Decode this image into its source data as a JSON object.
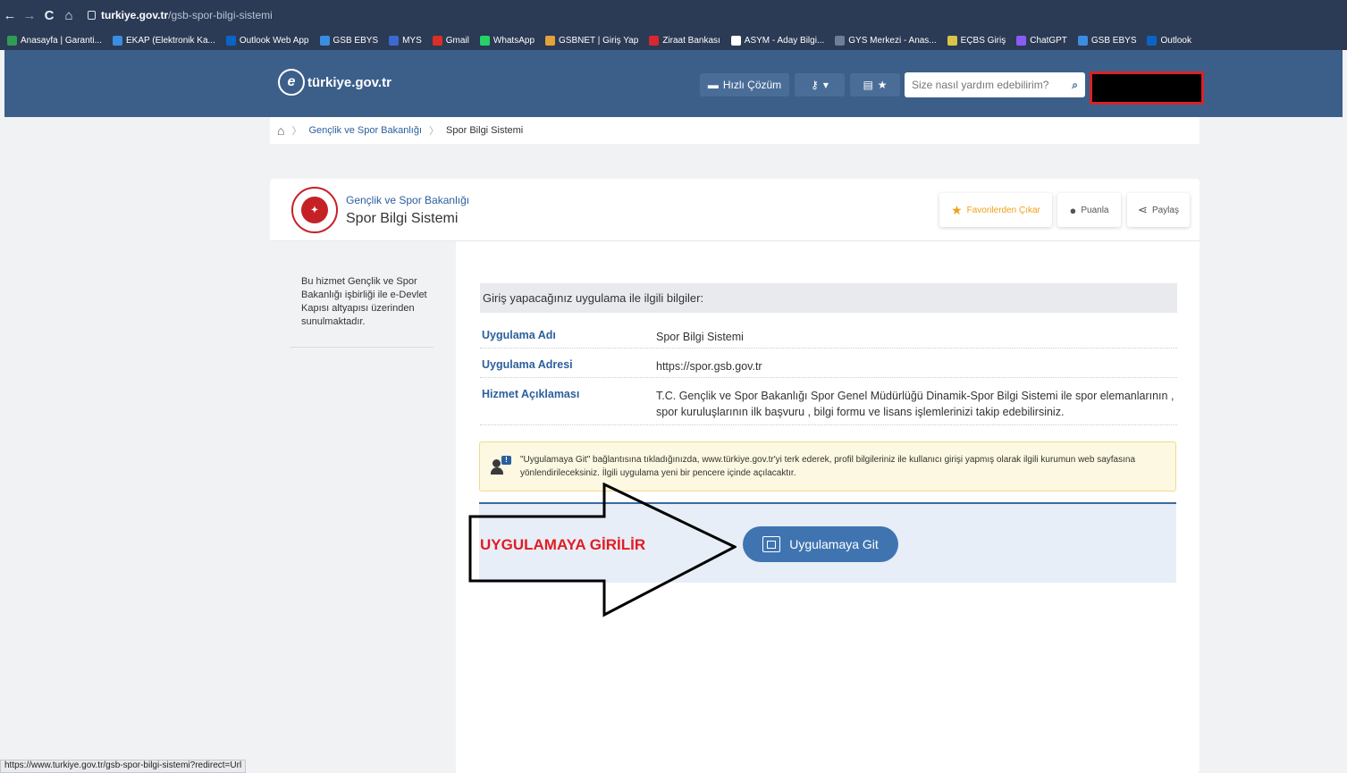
{
  "browser": {
    "url_host": "turkiye.gov.tr",
    "url_path": "/gsb-spor-bilgi-sistemi",
    "status_url": "https://www.turkiye.gov.tr/gsb-spor-bilgi-sistemi?redirect=Url"
  },
  "bookmarks": [
    {
      "label": "Anasayfa | Garanti...",
      "color": "#2e9c52"
    },
    {
      "label": "EKAP (Elektronik Ka...",
      "color": "#3a8de0"
    },
    {
      "label": "Outlook Web App",
      "color": "#0a64c6"
    },
    {
      "label": "GSB EBYS",
      "color": "#3a8de0"
    },
    {
      "label": "MYS",
      "color": "#3a6ad0"
    },
    {
      "label": "Gmail",
      "color": "#d93025"
    },
    {
      "label": "WhatsApp",
      "color": "#25d366"
    },
    {
      "label": "GSBNET | Giriş Yap",
      "color": "#e2a33b"
    },
    {
      "label": "Ziraat Bankası",
      "color": "#d9272e"
    },
    {
      "label": "ASYM - Aday Bilgi...",
      "color": "#ffffff"
    },
    {
      "label": "GYS Merkezi - Anas...",
      "color": "#6f7d96"
    },
    {
      "label": "EÇBS Giriş",
      "color": "#d9c44a"
    },
    {
      "label": "ChatGPT",
      "color": "#8a5cf6"
    },
    {
      "label": "GSB EBYS",
      "color": "#3a8de0"
    },
    {
      "label": "Outlook",
      "color": "#0a64c6"
    }
  ],
  "header": {
    "logo_text": "türkiye.gov.tr",
    "quick_solution": "Hızlı Çözüm",
    "search_placeholder": "Size nasıl yardım edebilirim?"
  },
  "breadcrumb": {
    "ministry": "Gençlik ve Spor Bakanlığı",
    "current": "Spor Bilgi Sistemi"
  },
  "card": {
    "org": "Gençlik ve Spor Bakanlığı",
    "service": "Spor Bilgi Sistemi",
    "favorite_label": "Favorilerden Çıkar",
    "rate_label": "Puanla",
    "share_label": "Paylaş"
  },
  "sidebar": {
    "text": "Bu hizmet Gençlik ve Spor Bakanlığı işbirliği ile e-Devlet Kapısı altyapısı üzerinden sunulmaktadır."
  },
  "info": {
    "title": "Giriş yapacağınız uygulama ile ilgili bilgiler:",
    "app_name_key": "Uygulama Adı",
    "app_name_val": "Spor Bilgi Sistemi",
    "app_addr_key": "Uygulama Adresi",
    "app_addr_val": "https://spor.gsb.gov.tr",
    "desc_key": "Hizmet Açıklaması",
    "desc_val": "T.C. Gençlik ve Spor Bakanlığı Spor Genel Müdürlüğü Dinamik-Spor Bilgi Sistemi ile spor elemanlarının , spor kuruluşlarının ilk başvuru , bilgi formu ve lisans işlemlerinizi takip edebilirsiniz."
  },
  "notice": {
    "text": "\"Uygulamaya Git\" bağlantısına tıkladığınızda, www.türkiye.gov.tr'yi terk ederek, profil bilgileriniz ile kullanıcı girişi yapmış olarak ilgili kurumun web sayfasına yönlendirileceksiniz. İlgili uygulama yeni bir pencere içinde açılacaktır."
  },
  "go_button": "Uygulamaya Git",
  "annotation": "UYGULAMAYA GİRİLİR"
}
